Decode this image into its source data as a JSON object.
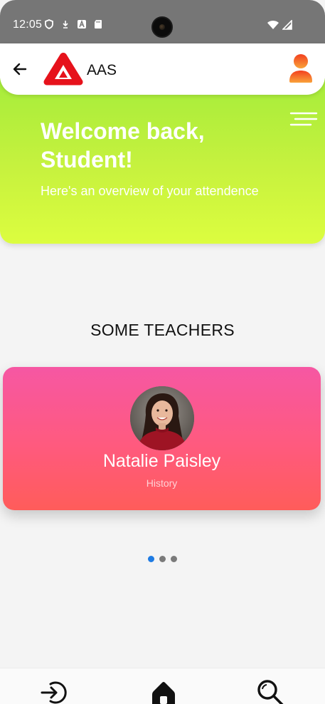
{
  "status_bar": {
    "time": "12:05",
    "left_icons": [
      "shield-icon",
      "download-icon",
      "a-icon",
      "sd-card-icon"
    ],
    "right_icons": [
      "wifi-icon",
      "signal-icon"
    ]
  },
  "app_bar": {
    "title": "AAS",
    "back_icon": "arrow-left-icon",
    "logo_icon": "aas-logo-icon",
    "profile_icon": "user-profile-icon"
  },
  "hero": {
    "title": "Welcome back, Student!",
    "subtitle": "Here's an overview of your attendence",
    "menu_icon": "menu-lines-icon",
    "gradient": [
      "#a6ec3b",
      "#dcfd3f"
    ]
  },
  "section": {
    "title": "SOME TEACHERS"
  },
  "teachers": [
    {
      "name": "Natalie Paisley",
      "subject": "History"
    }
  ],
  "carousel": {
    "page_count": 3,
    "active_index": 0,
    "active_color": "#1e7be3",
    "inactive_color": "#7a7a7a"
  },
  "bottom_nav": {
    "items": [
      {
        "id": "login",
        "icon": "login-icon"
      },
      {
        "id": "home",
        "icon": "home-icon"
      },
      {
        "id": "search",
        "icon": "search-icon"
      }
    ]
  },
  "colors": {
    "card_gradient": [
      "#f657a3",
      "#ff5c5a"
    ],
    "profile_icon": "#f85a1e"
  }
}
